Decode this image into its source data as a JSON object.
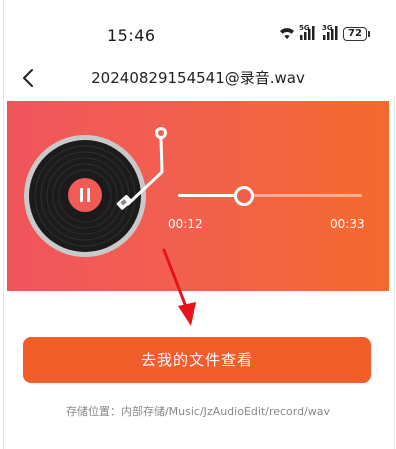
{
  "status_bar": {
    "time": "15:46",
    "network_1": "5G",
    "network_2": "3G",
    "battery": "72",
    "icons": [
      "wifi-icon",
      "signal-icon",
      "signal-icon",
      "battery-icon"
    ]
  },
  "header": {
    "title": "20240829154541@录音.wav",
    "back_icon": "chevron-left-icon"
  },
  "player": {
    "current_time": "00:12",
    "total_time": "00:33",
    "progress": 0.36,
    "state_icon": "pause-icon",
    "colors": {
      "gradient_start": "#f0545d",
      "gradient_end": "#f46a2d",
      "accent": "#f15e2a"
    }
  },
  "actions": {
    "open_files_label": "去我的文件查看"
  },
  "footer": {
    "storage_path": "存储位置：内部存储/Music/JzAudioEdit/record/wav"
  }
}
